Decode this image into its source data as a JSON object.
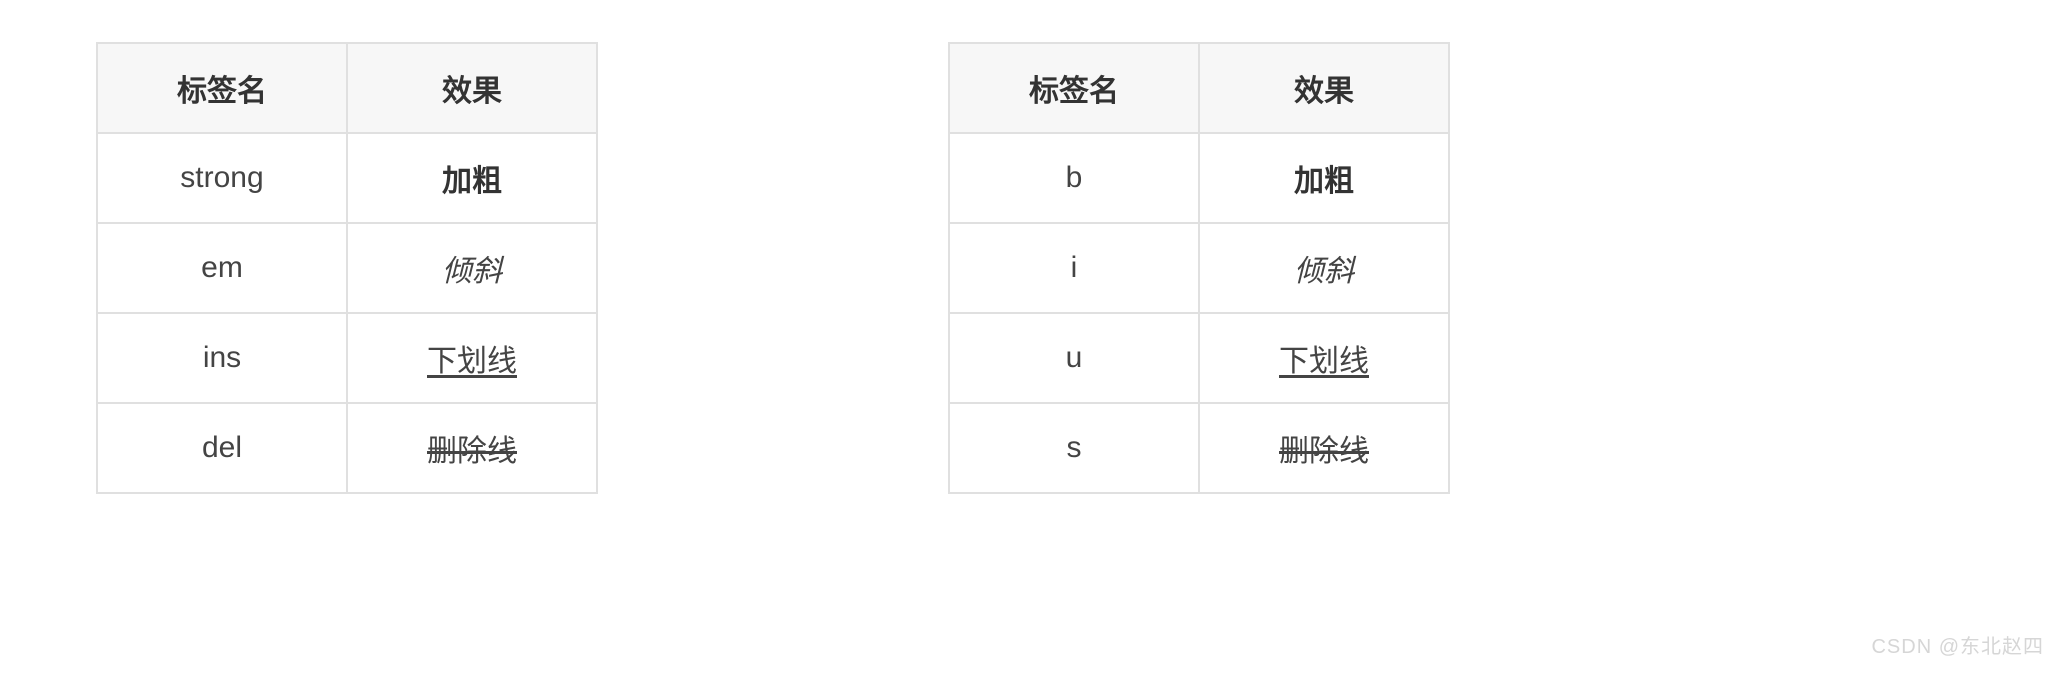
{
  "tables": [
    {
      "headers": [
        "标签名",
        "效果"
      ],
      "rows": [
        {
          "tag": "strong",
          "effect": "加粗",
          "style": "bold"
        },
        {
          "tag": "em",
          "effect": "倾斜",
          "style": "italic"
        },
        {
          "tag": "ins",
          "effect": "下划线",
          "style": "underline"
        },
        {
          "tag": "del",
          "effect": "删除线",
          "style": "strike"
        }
      ]
    },
    {
      "headers": [
        "标签名",
        "效果"
      ],
      "rows": [
        {
          "tag": "b",
          "effect": "加粗",
          "style": "bold"
        },
        {
          "tag": "i",
          "effect": "倾斜",
          "style": "italic"
        },
        {
          "tag": "u",
          "effect": "下划线",
          "style": "underline"
        },
        {
          "tag": "s",
          "effect": "删除线",
          "style": "strike"
        }
      ]
    }
  ],
  "watermark": "CSDN @东北赵四"
}
